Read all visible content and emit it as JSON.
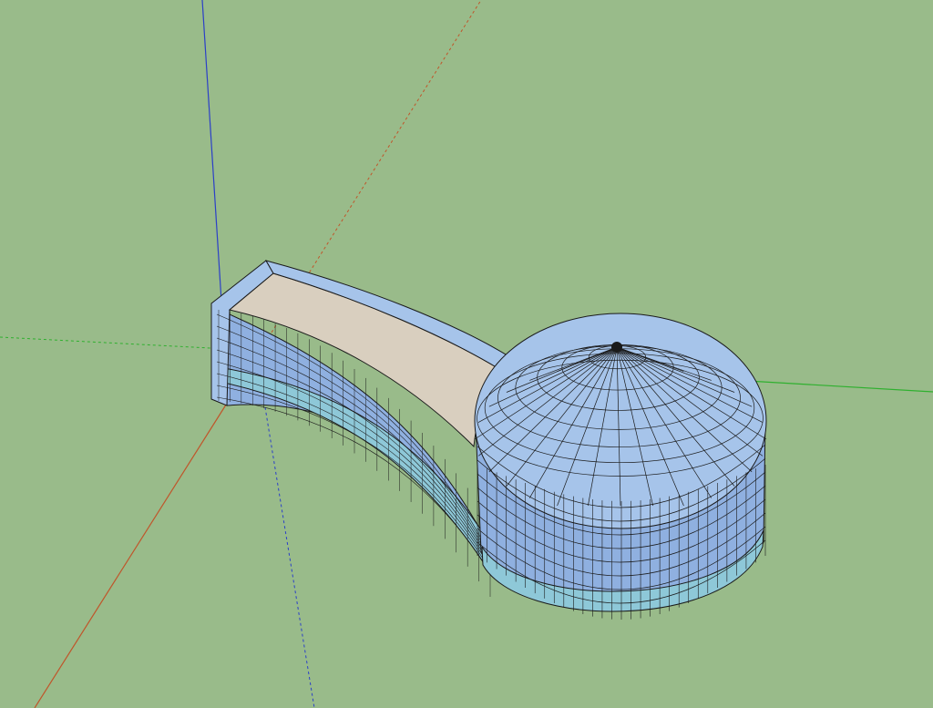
{
  "app": {
    "window_title": ""
  },
  "viewport": {
    "background_color": "#99bb8a",
    "view": "iso"
  },
  "axes": {
    "red_color": "#c0552a",
    "green_color": "#2fb02f",
    "blue_color": "#2b3fc8"
  },
  "model": {
    "wall_fill": "#8fb0e0",
    "wall_fill_light": "#a6c4ea",
    "wall_base_fill": "#8ec8d8",
    "floor_fill": "#d9cfbf",
    "edge_color": "#1a1a1a",
    "components": [
      "curved-wall-wing",
      "domed-tower"
    ]
  }
}
